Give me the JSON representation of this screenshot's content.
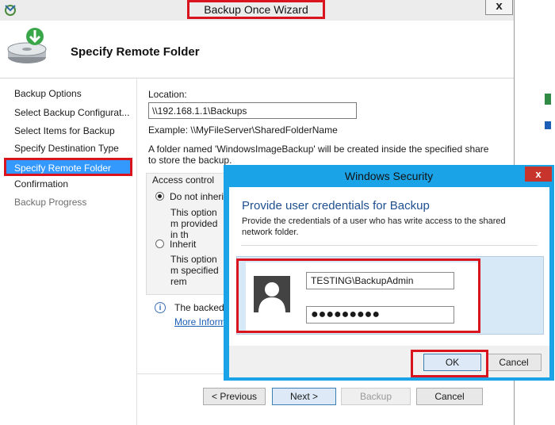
{
  "wizard": {
    "title": "Backup Once Wizard",
    "close_glyph": "x",
    "header_title": "Specify Remote Folder",
    "icon": "backup-disk-icon"
  },
  "nav": {
    "items": [
      {
        "label": "Backup Options"
      },
      {
        "label": "Select Backup Configurat..."
      },
      {
        "label": "Select Items for Backup"
      },
      {
        "label": "Specify Destination Type"
      },
      {
        "label": "Specify Remote Folder"
      },
      {
        "label": "Confirmation"
      },
      {
        "label": "Backup Progress"
      }
    ],
    "selected_index": 4
  },
  "content": {
    "location_label": "Location:",
    "location_value": "\\\\192.168.1.1\\Backups",
    "example": "Example: \\\\MyFileServer\\SharedFolderName",
    "folder_note": "A folder named 'WindowsImageBackup' will be created inside the specified share to store the backup.",
    "access_control_label": "Access control",
    "radio1_label": "Do not inherit",
    "radio1_desc": "This option m provided in th",
    "radio2_label": "Inherit",
    "radio2_desc": "This option m specified rem",
    "info_text": "The backed",
    "info_link": "More Inform"
  },
  "buttons": {
    "previous": "< Previous",
    "next": "Next >",
    "backup": "Backup",
    "cancel": "Cancel"
  },
  "security": {
    "title": "Windows Security",
    "close_glyph": "x",
    "heading": "Provide user credentials for Backup",
    "description": "Provide the credentials of a user who has write access to the shared network folder.",
    "username": "TESTING\\BackupAdmin",
    "password_mask": "●●●●●●●●●",
    "ok": "OK",
    "cancel": "Cancel"
  },
  "colors": {
    "highlight_red": "#d9141f",
    "selection_blue": "#3399ff",
    "dialog_border_blue": "#1ba3e8",
    "heading_blue": "#1f4f8f"
  }
}
